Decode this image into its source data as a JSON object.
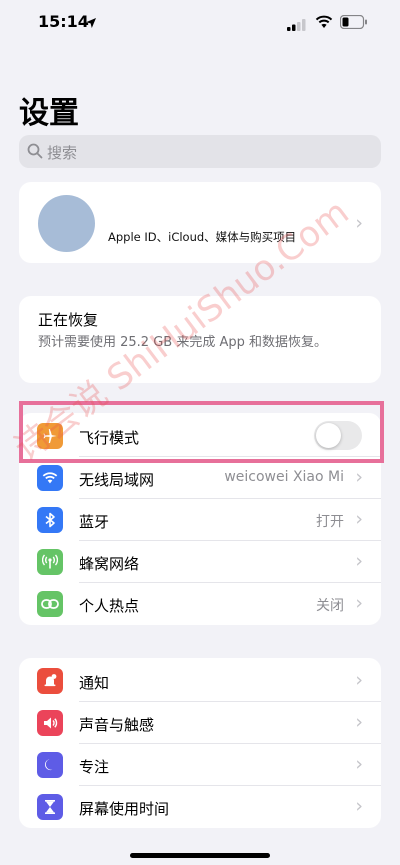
{
  "status_bar": {
    "time": "15:14",
    "icons": [
      "location-arrow-icon",
      "cellular-signal-icon",
      "wifi-icon",
      "battery-icon"
    ]
  },
  "page": {
    "title": "设置"
  },
  "search": {
    "placeholder": "搜索"
  },
  "apple_id": {
    "label": "Apple ID、iCloud、媒体与购买项目"
  },
  "restore": {
    "title": "正在恢复",
    "description": "预计需要使用 25.2 GB 来完成 App 和数据恢复。"
  },
  "connectivity": {
    "rows": [
      {
        "label": "飞行模式",
        "icon": "airplane-icon",
        "color": "#f09a37",
        "toggle": false
      },
      {
        "label": "无线局域网",
        "value": "weicowei Xiao Mi",
        "icon": "wifi-icon",
        "color": "#3478f6"
      },
      {
        "label": "蓝牙",
        "value": "打开",
        "icon": "bluetooth-icon",
        "color": "#3478f6"
      },
      {
        "label": "蜂窝网络",
        "icon": "cellular-antenna-icon",
        "color": "#65c466"
      },
      {
        "label": "个人热点",
        "value": "关闭",
        "icon": "hotspot-icon",
        "color": "#65c466"
      }
    ]
  },
  "notifications_group": {
    "rows": [
      {
        "label": "通知",
        "icon": "notification-bell-icon",
        "color": "#eb4e3d"
      },
      {
        "label": "声音与触感",
        "icon": "speaker-icon",
        "color": "#eb445a"
      },
      {
        "label": "专注",
        "icon": "moon-icon",
        "color": "#5e5ce6"
      },
      {
        "label": "屏幕使用时间",
        "icon": "hourglass-icon",
        "color": "#5e5ce6"
      }
    ]
  },
  "highlight_color": "#e7709a",
  "watermark": {
    "text": "诗会说 ShiHuiShuo.Com"
  }
}
